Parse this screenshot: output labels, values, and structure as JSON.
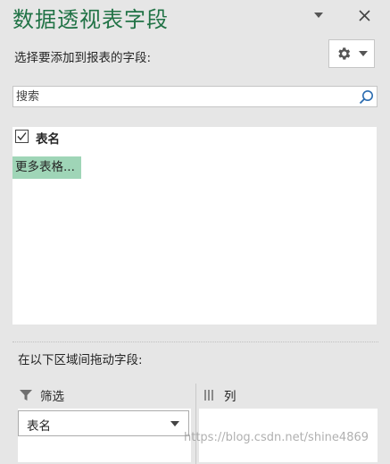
{
  "pane": {
    "title": "数据透视表字段",
    "subtitle": "选择要添加到报表的字段:"
  },
  "search": {
    "placeholder": "搜索",
    "value": ""
  },
  "fields": [
    {
      "label": "表名",
      "checked": true
    }
  ],
  "more_tables_link": "更多表格...",
  "areas": {
    "instruction": "在以下区域间拖动字段:",
    "filter": {
      "label": "筛选",
      "items": [
        "表名"
      ]
    },
    "columns": {
      "label": "列",
      "items": []
    }
  },
  "watermark": "https://blog.csdn.net/shine4869",
  "colors": {
    "accent": "#217346",
    "selection": "#9fd5b7",
    "panel_bg": "#e6e6e6"
  },
  "icons": [
    "chevron-down-icon",
    "close-icon",
    "gear-icon",
    "search-icon",
    "checkmark-icon",
    "funnel-icon",
    "columns-icon"
  ]
}
